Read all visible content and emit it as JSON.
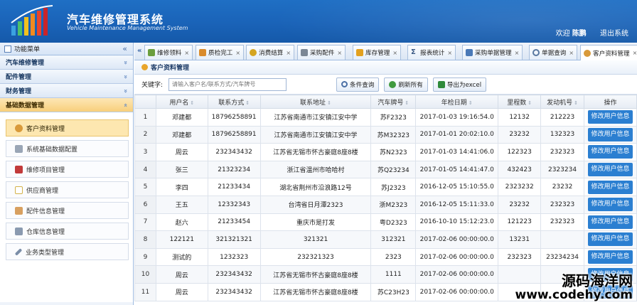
{
  "header": {
    "app_title": "汽车维修管理系统",
    "app_subtitle": "Vehicle Maintenance Management System",
    "welcome": "欢迎",
    "username": "陈鹏",
    "logout": "退出系统"
  },
  "sidebar": {
    "title": "功能菜单",
    "collapse_glyph": "«",
    "sections": [
      {
        "label": "汽车维修管理",
        "glyph": "»"
      },
      {
        "label": "配件管理",
        "glyph": "»"
      },
      {
        "label": "财务管理",
        "glyph": "»"
      },
      {
        "label": "基础数据管理",
        "glyph": "«"
      }
    ],
    "items": [
      {
        "label": "客户资料管理",
        "icon": "customer-icon",
        "color": "#d99a3a"
      },
      {
        "label": "系统基础数据配置",
        "icon": "config-icon",
        "color": "#9aa6b6"
      },
      {
        "label": "维修项目管理",
        "icon": "repair-icon",
        "color": "#c23a3a"
      },
      {
        "label": "供应商管理",
        "icon": "document-icon",
        "color": "#d4b24a"
      },
      {
        "label": "配件信息管理",
        "icon": "parts-icon",
        "color": "#d8a060"
      },
      {
        "label": "仓库信息管理",
        "icon": "warehouse-icon",
        "color": "#8a9ab0"
      },
      {
        "label": "业务类型管理",
        "icon": "wrench-icon",
        "color": "#7b8ea8"
      }
    ]
  },
  "tabs": {
    "scroll_glyph": "«",
    "items": [
      {
        "label": "维修领料",
        "icon": "pick-icon",
        "color": "#6b9e3e"
      },
      {
        "label": "质检完工",
        "icon": "check-icon",
        "color": "#d98b2c"
      },
      {
        "label": "消费结算",
        "icon": "settle-icon",
        "color": "#d5a521"
      },
      {
        "label": "采购配件",
        "icon": "purchase-icon",
        "color": "#7b8795"
      },
      {
        "label": "库存管理",
        "icon": "stock-icon",
        "color": "#e3a11f"
      },
      {
        "label": "报表统计",
        "icon": "sum-icon",
        "color": "#3b5a85"
      },
      {
        "label": "采购单据管理",
        "icon": "form-icon",
        "color": "#4a79b7"
      },
      {
        "label": "单据查询",
        "icon": "search-icon",
        "color": "#5978a0"
      },
      {
        "label": "客户资料管理",
        "icon": "customer-icon",
        "color": "#d99a3a"
      }
    ],
    "close_glyph": "×"
  },
  "content": {
    "panel_title": "客户资料管理",
    "keyword_label": "关键字:",
    "search_placeholder": "请输入客户名/联系方式/汽车牌号",
    "buttons": {
      "search": "条件查询",
      "refresh": "刷新所有",
      "export": "导出为excel"
    },
    "accent": "#2b7fd1"
  },
  "table": {
    "columns": [
      "用户名",
      "联系方式",
      "联系地址",
      "汽车牌号",
      "年检日期",
      "里程数",
      "发动机号",
      "操作"
    ],
    "sort_glyph": "⇕",
    "action_label": "修改用户信息",
    "rows": [
      [
        "1",
        "邓建都",
        "18796258891",
        "江苏省南通市江安镇江安中学",
        "苏F2323",
        "2017-01-03 19:16:54.0",
        "12132",
        "212223"
      ],
      [
        "2",
        "邓建都",
        "18796258891",
        "江苏省南通市江安镇江安中学",
        "苏M32323",
        "2017-01-01 20:02:10.0",
        "23232",
        "132323"
      ],
      [
        "3",
        "周云",
        "232343432",
        "江苏省无锡市怀古豪庭8座8楼",
        "苏N2323",
        "2017-01-03 14:41:06.0",
        "122323",
        "232323"
      ],
      [
        "4",
        "张三",
        "21323234",
        "浙江省温州市哈哈村",
        "苏Q23234",
        "2017-01-05 14:41:47.0",
        "432423",
        "2323234"
      ],
      [
        "5",
        "李四",
        "21233434",
        "湖北省荆州市沿浪路12号",
        "苏J2323",
        "2016-12-05 15:10:55.0",
        "2323232",
        "23232"
      ],
      [
        "6",
        "王五",
        "12332343",
        "台湾省日月潭2323",
        "浙M2323",
        "2016-12-05 15:11:33.0",
        "23232",
        "232323"
      ],
      [
        "7",
        "赵六",
        "21233454",
        "重庆市是打发",
        "粤D2323",
        "2016-10-10 15:12:23.0",
        "121223",
        "232323"
      ],
      [
        "8",
        "122121",
        "321321321",
        "321321",
        "312321",
        "2017-02-06 00:00:00.0",
        "13231",
        ""
      ],
      [
        "9",
        "测试的",
        "1232323",
        "232321323",
        "2323",
        "2017-02-06 00:00:00.0",
        "232323",
        "23234234"
      ],
      [
        "10",
        "周云",
        "232343432",
        "江苏省无锡市怀古豪庭8座8楼",
        "1111",
        "2017-02-06 00:00:00.0",
        "",
        ""
      ],
      [
        "11",
        "周云",
        "232343432",
        "江苏省无锡市怀古豪庭8座8楼",
        "苏C23H23",
        "2017-02-06 00:00:00.0",
        "",
        ""
      ]
    ]
  },
  "watermark": {
    "line1": "源码海洋网",
    "line2": "www.codehy.com"
  }
}
